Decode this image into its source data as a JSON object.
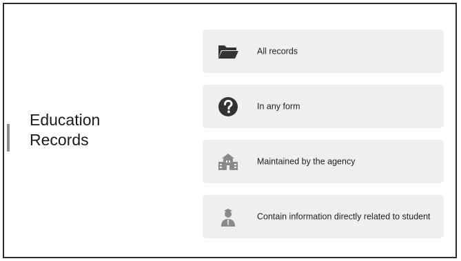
{
  "slide": {
    "title_line1": "Education",
    "title_line2": "Records"
  },
  "cards": [
    {
      "label": "All records",
      "icon": "folder-icon"
    },
    {
      "label": "In any form",
      "icon": "question-circle-icon"
    },
    {
      "label": "Maintained by the agency",
      "icon": "school-building-icon"
    },
    {
      "label": "Contain information directly related to student",
      "icon": "student-icon"
    }
  ],
  "colors": {
    "card_background": "#efefef",
    "icon_dark": "#333333",
    "icon_gray": "#8a8a8a",
    "border": "#2b2b2b"
  }
}
